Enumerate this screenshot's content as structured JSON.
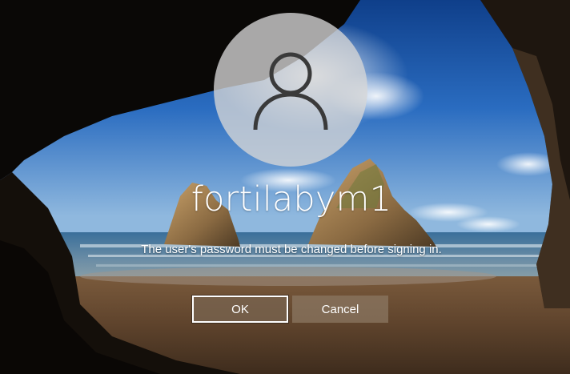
{
  "login": {
    "username": "fortilabym1",
    "message": "The user's password must be changed before signing in."
  },
  "buttons": {
    "ok_label": "OK",
    "cancel_label": "Cancel"
  },
  "icons": {
    "avatar": "user-avatar-icon"
  },
  "colors": {
    "text": "#ffffff",
    "button_bg": "#7a6550",
    "avatar_bg": "#d6d6d6"
  }
}
